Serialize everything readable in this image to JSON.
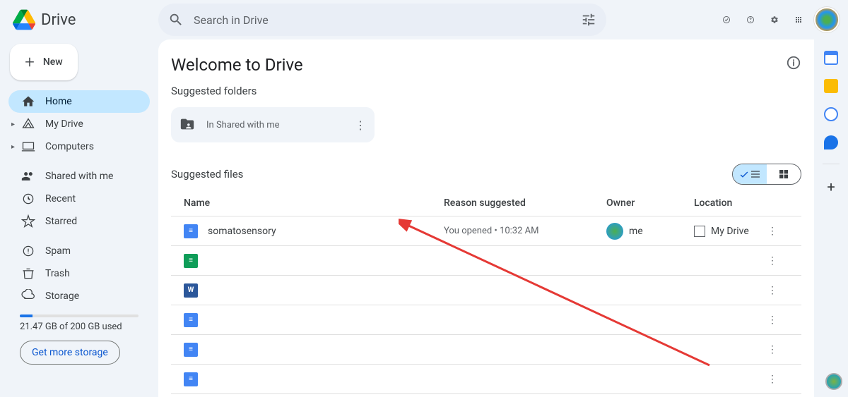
{
  "header": {
    "product": "Drive",
    "search_placeholder": "Search in Drive"
  },
  "sidebar": {
    "new_label": "New",
    "items": [
      {
        "label": "Home"
      },
      {
        "label": "My Drive"
      },
      {
        "label": "Computers"
      },
      {
        "label": "Shared with me"
      },
      {
        "label": "Recent"
      },
      {
        "label": "Starred"
      },
      {
        "label": "Spam"
      },
      {
        "label": "Trash"
      },
      {
        "label": "Storage"
      }
    ],
    "storage_text": "21.47 GB of 200 GB used",
    "get_more_label": "Get more storage"
  },
  "content": {
    "title": "Welcome to Drive",
    "suggested_folders_label": "Suggested folders",
    "folder_card_label": "In Shared with me",
    "suggested_files_label": "Suggested files",
    "columns": {
      "name": "Name",
      "reason": "Reason suggested",
      "owner": "Owner",
      "location": "Location"
    },
    "files": [
      {
        "name": "somatosensory",
        "reason": "You opened • 10:32 AM",
        "owner": "me",
        "location": "My Drive",
        "type": "docs"
      },
      {
        "name": "",
        "reason": "",
        "owner": "",
        "location": "",
        "type": "sheets"
      },
      {
        "name": "",
        "reason": "",
        "owner": "",
        "location": "",
        "type": "word"
      },
      {
        "name": "",
        "reason": "",
        "owner": "",
        "location": "",
        "type": "docs"
      },
      {
        "name": "",
        "reason": "",
        "owner": "",
        "location": "",
        "type": "docs"
      },
      {
        "name": "",
        "reason": "",
        "owner": "",
        "location": "",
        "type": "docs"
      }
    ]
  }
}
